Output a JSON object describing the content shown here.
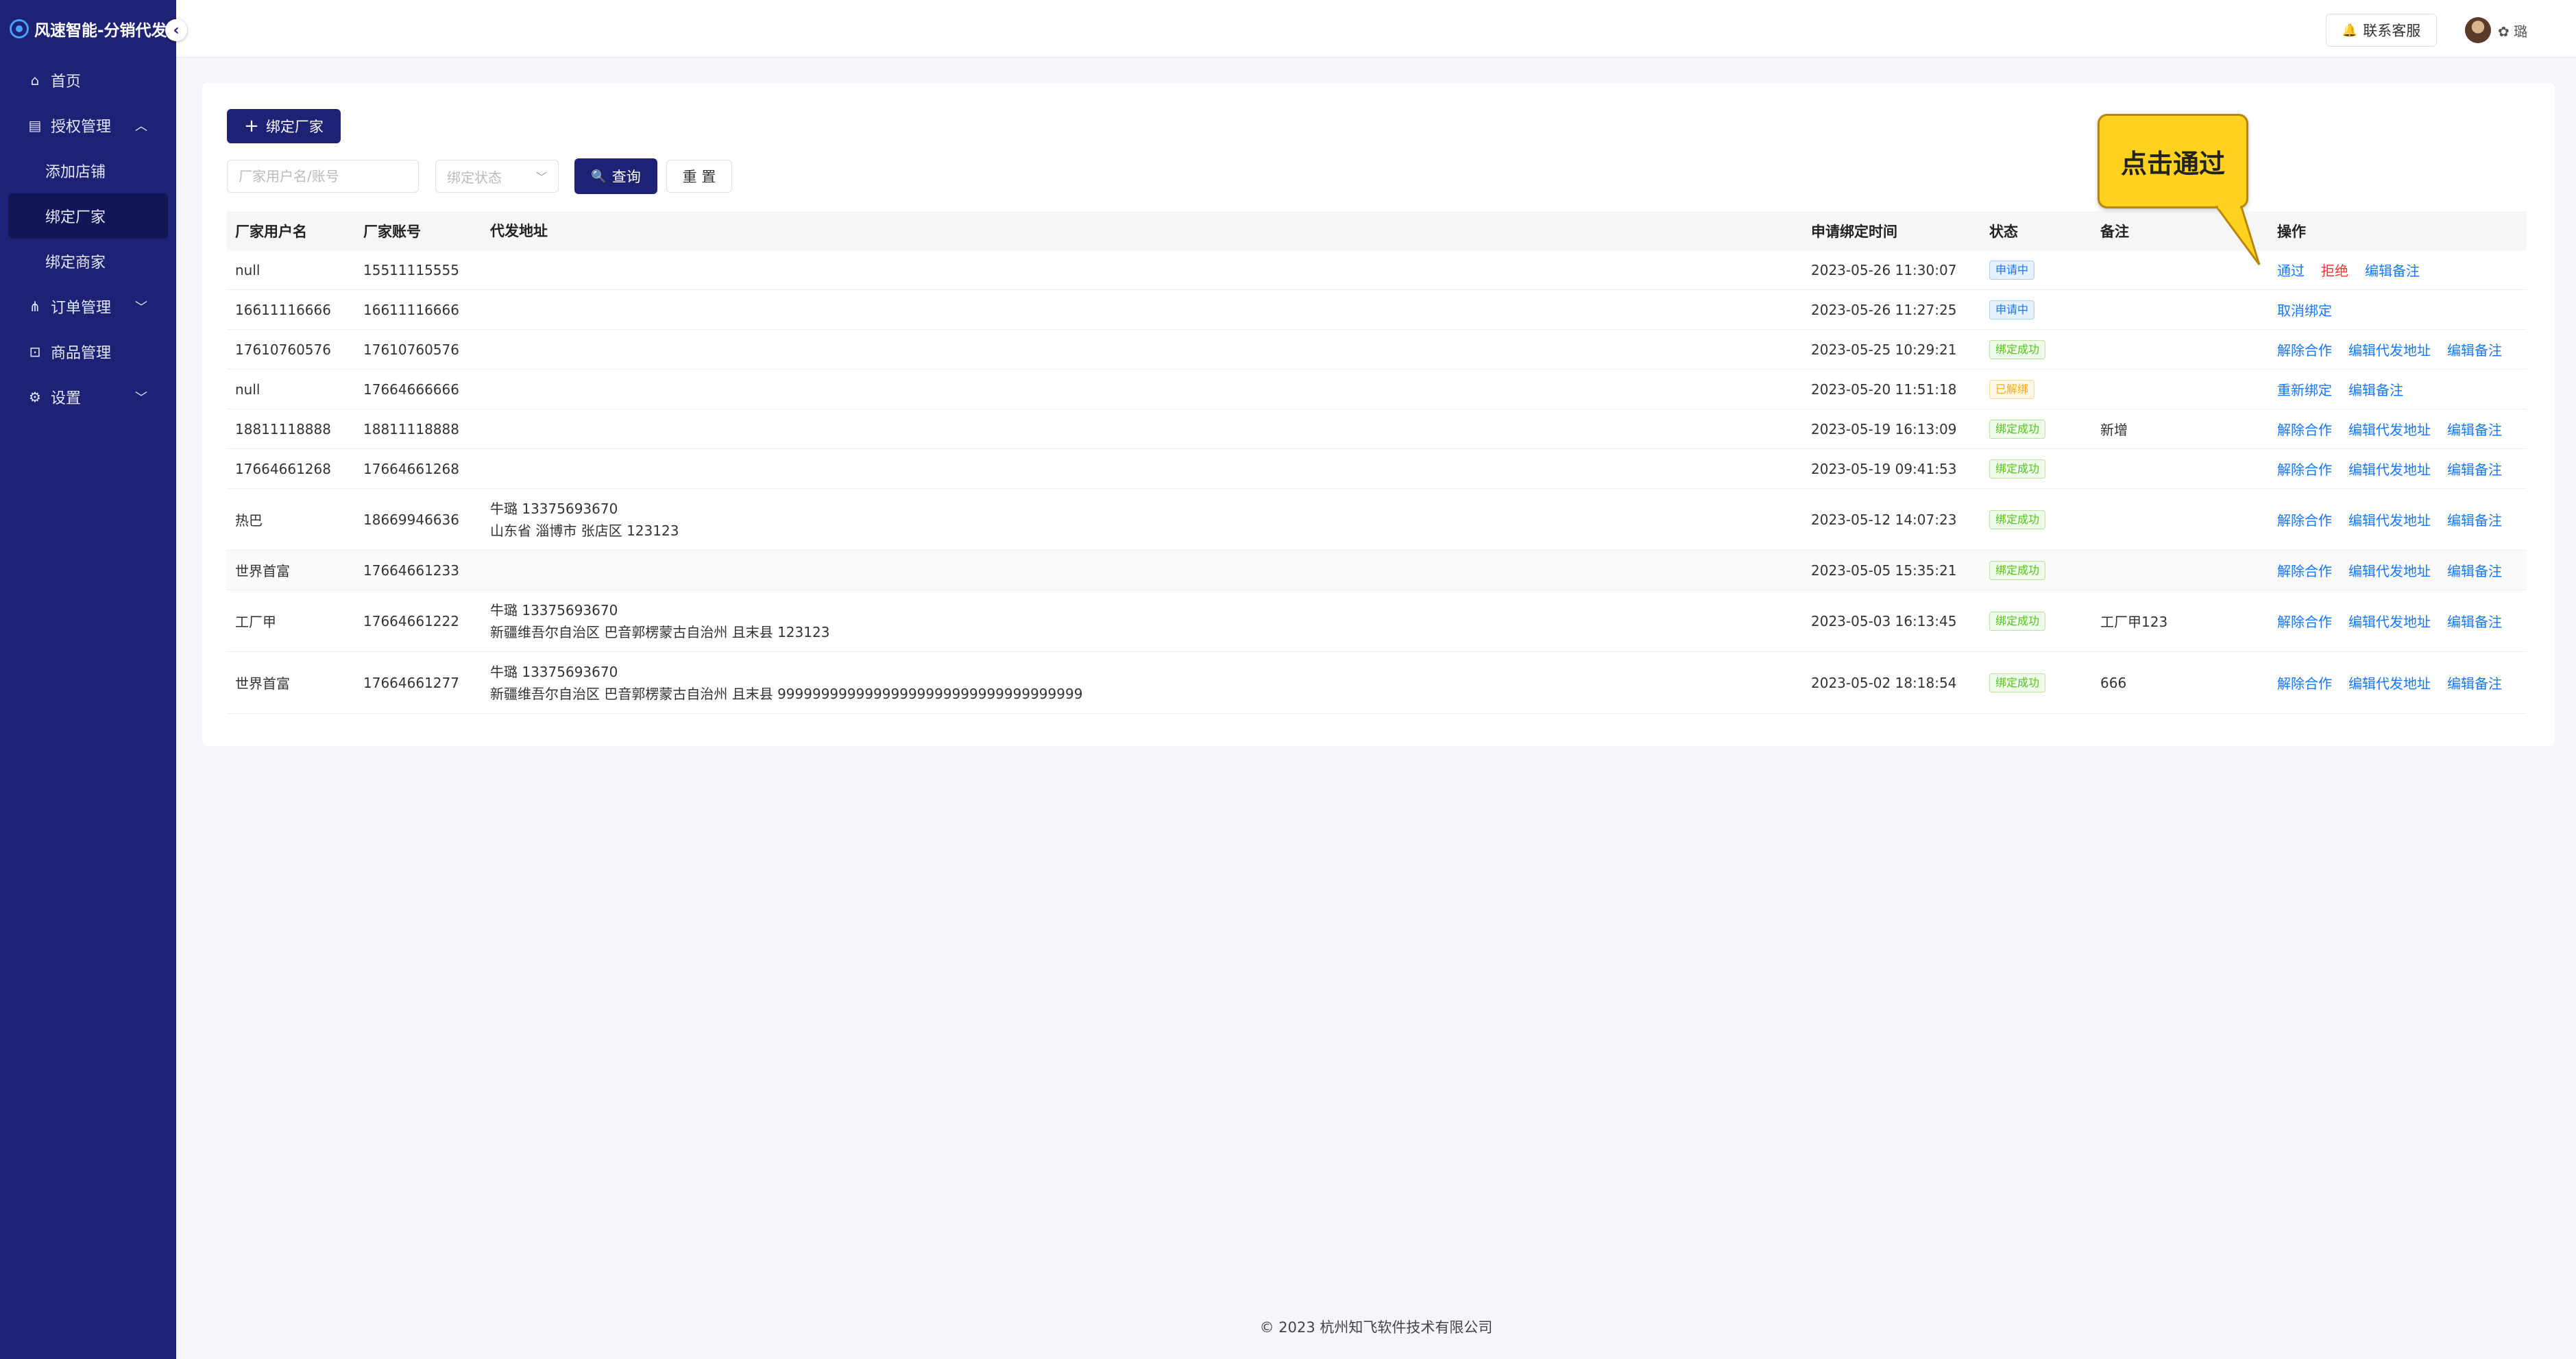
{
  "app": {
    "brand": "风速智能-分销代发",
    "collapse_icon": "chevron-left-icon"
  },
  "sidebar": {
    "items": [
      {
        "label": "首页",
        "icon": "home-icon"
      },
      {
        "label": "授权管理",
        "icon": "document-icon",
        "expanded": true,
        "children": [
          {
            "label": "添加店铺"
          },
          {
            "label": "绑定厂家",
            "active": true
          },
          {
            "label": "绑定商家"
          }
        ]
      },
      {
        "label": "订单管理",
        "icon": "network-icon",
        "expanded": false
      },
      {
        "label": "商品管理",
        "icon": "lock-icon"
      },
      {
        "label": "设置",
        "icon": "gear-icon",
        "expanded": false
      }
    ]
  },
  "header": {
    "support_label": "联系客服",
    "username": "璐"
  },
  "toolbar": {
    "bind_label": "绑定厂家",
    "search_placeholder": "厂家用户名/账号",
    "status_placeholder": "绑定状态",
    "query_label": "查询",
    "reset_label": "重 置"
  },
  "table": {
    "columns": [
      "厂家用户名",
      "厂家账号",
      "代发地址",
      "申请绑定时间",
      "状态",
      "备注",
      "操作"
    ],
    "rows": [
      {
        "name": "null",
        "account": "15511115555",
        "addr1": "",
        "addr2": "",
        "time": "2023-05-26 11:30:07",
        "status": "申请中",
        "status_type": "pending",
        "note": "",
        "ops": [
          "通过",
          "拒绝",
          "编辑备注"
        ]
      },
      {
        "name": "16611116666",
        "account": "16611116666",
        "addr1": "",
        "addr2": "",
        "time": "2023-05-26 11:27:25",
        "status": "申请中",
        "status_type": "pending",
        "note": "",
        "ops": [
          "取消绑定"
        ]
      },
      {
        "name": "17610760576",
        "account": "17610760576",
        "addr1": "",
        "addr2": "",
        "time": "2023-05-25 10:29:21",
        "status": "绑定成功",
        "status_type": "success",
        "note": "",
        "ops": [
          "解除合作",
          "编辑代发地址",
          "编辑备注"
        ]
      },
      {
        "name": "null",
        "account": "17664666666",
        "addr1": "",
        "addr2": "",
        "time": "2023-05-20 11:51:18",
        "status": "已解绑",
        "status_type": "released",
        "note": "",
        "ops": [
          "重新绑定",
          "编辑备注"
        ]
      },
      {
        "name": "18811118888",
        "account": "18811118888",
        "addr1": "",
        "addr2": "",
        "time": "2023-05-19 16:13:09",
        "status": "绑定成功",
        "status_type": "success",
        "note": "新增",
        "ops": [
          "解除合作",
          "编辑代发地址",
          "编辑备注"
        ]
      },
      {
        "name": "17664661268",
        "account": "17664661268",
        "addr1": "",
        "addr2": "",
        "time": "2023-05-19 09:41:53",
        "status": "绑定成功",
        "status_type": "success",
        "note": "",
        "ops": [
          "解除合作",
          "编辑代发地址",
          "编辑备注"
        ]
      },
      {
        "name": "热巴",
        "account": "18669946636",
        "addr1": "牛璐 13375693670",
        "addr2": "山东省 淄博市 张店区 123123",
        "time": "2023-05-12 14:07:23",
        "status": "绑定成功",
        "status_type": "success",
        "note": "",
        "ops": [
          "解除合作",
          "编辑代发地址",
          "编辑备注"
        ]
      },
      {
        "name": "世界首富",
        "account": "17664661233",
        "addr1": "",
        "addr2": "",
        "time": "2023-05-05 15:35:21",
        "status": "绑定成功",
        "status_type": "success",
        "note": "",
        "ops": [
          "解除合作",
          "编辑代发地址",
          "编辑备注"
        ]
      },
      {
        "name": "工厂甲",
        "account": "17664661222",
        "addr1": "牛璐 13375693670",
        "addr2": "新疆维吾尔自治区 巴音郭楞蒙古自治州 且末县 123123",
        "time": "2023-05-03 16:13:45",
        "status": "绑定成功",
        "status_type": "success",
        "note": "工厂甲123",
        "ops": [
          "解除合作",
          "编辑代发地址",
          "编辑备注"
        ]
      },
      {
        "name": "世界首富",
        "account": "17664661277",
        "addr1": "牛璐 13375693670",
        "addr2": "新疆维吾尔自治区 巴音郭楞蒙古自治州 且末县 99999999999999999999999999999999999",
        "time": "2023-05-02 18:18:54",
        "status": "绑定成功",
        "status_type": "success",
        "note": "666",
        "ops": [
          "解除合作",
          "编辑代发地址",
          "编辑备注"
        ]
      }
    ]
  },
  "callout": {
    "text": "点击通过",
    "color": "#ffd21f"
  },
  "footer": {
    "copyright": "© 2023 杭州知飞软件技术有限公司"
  },
  "colors": {
    "sidebar_bg": "#1d2274",
    "primary": "#1d2274",
    "link": "#1677ff",
    "danger": "#ff3333"
  }
}
